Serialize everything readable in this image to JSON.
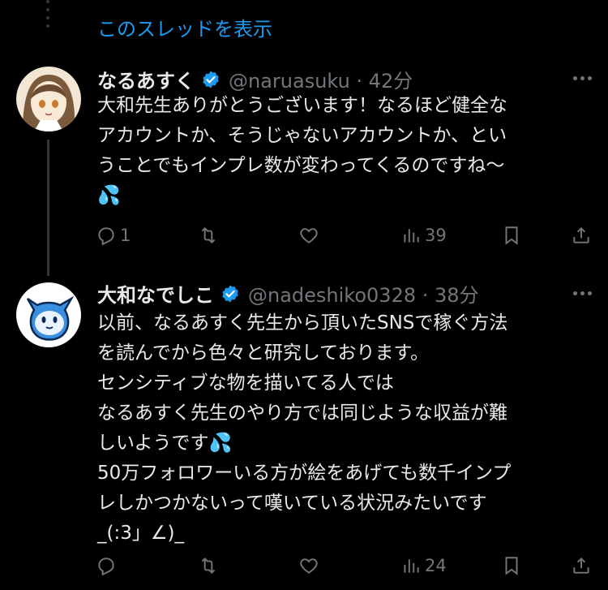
{
  "thread": {
    "show_thread_label": "このスレッドを表示"
  },
  "tweets": [
    {
      "name": "なるあすく",
      "handle_time": "@naruasuku · 42分",
      "lines": [
        "大和先生ありがとうございます！なるほど健全な",
        "アカウントか、そうじゃないアカウントか、とい",
        "うことでもインプレ数が変わってくるのですね〜"
      ],
      "emoji": "💦",
      "stats": {
        "replies": "1",
        "retweets": "",
        "likes": "",
        "views": "39"
      }
    },
    {
      "name": "大和なでしこ",
      "handle_time": "@nadeshiko0328 · 38分",
      "lines": [
        "以前、なるあすく先生から頂いたSNSで稼ぐ方法",
        "を読んでから色々と研究しております。",
        "センシティブな物を描いてる人では",
        "なるあすく先生のやり方では同じような収益が難",
        "しいようです💦",
        "50万フォロワーいる方が絵をあげても数千インプ",
        "レしかつかないって嘆いている状況みたいです",
        "_(:3」∠)_"
      ],
      "stats": {
        "replies": "",
        "retweets": "",
        "likes": "",
        "views": "24"
      }
    }
  ],
  "colors": {
    "accent": "#1d9bf0",
    "muted": "#71767b",
    "text": "#e7e9ea",
    "background": "#000000"
  },
  "icons": [
    "reply-icon",
    "retweet-icon",
    "like-icon",
    "views-icon",
    "bookmark-icon",
    "share-icon",
    "verified-icon",
    "more-icon"
  ]
}
